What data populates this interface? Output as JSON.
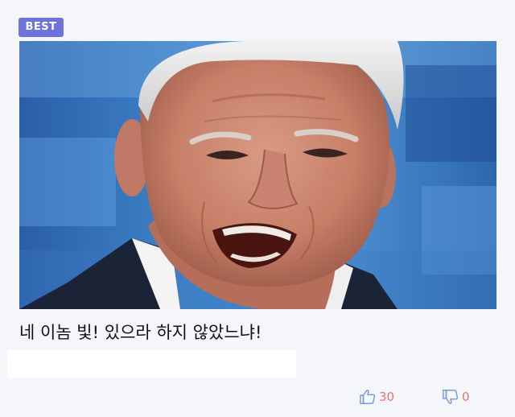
{
  "badge": {
    "label": "BEST",
    "color": "#6d73d8"
  },
  "post": {
    "photo_icon": "man-shouting-photo",
    "headline": "네 이놈 빛! 있으라 하지 않았느냐!"
  },
  "votes": {
    "up_icon": "thumbs-up-icon",
    "up_count": "30",
    "down_icon": "thumbs-down-icon",
    "down_count": "0",
    "icon_color": "#7a9ad6",
    "count_color": "#e07878"
  }
}
